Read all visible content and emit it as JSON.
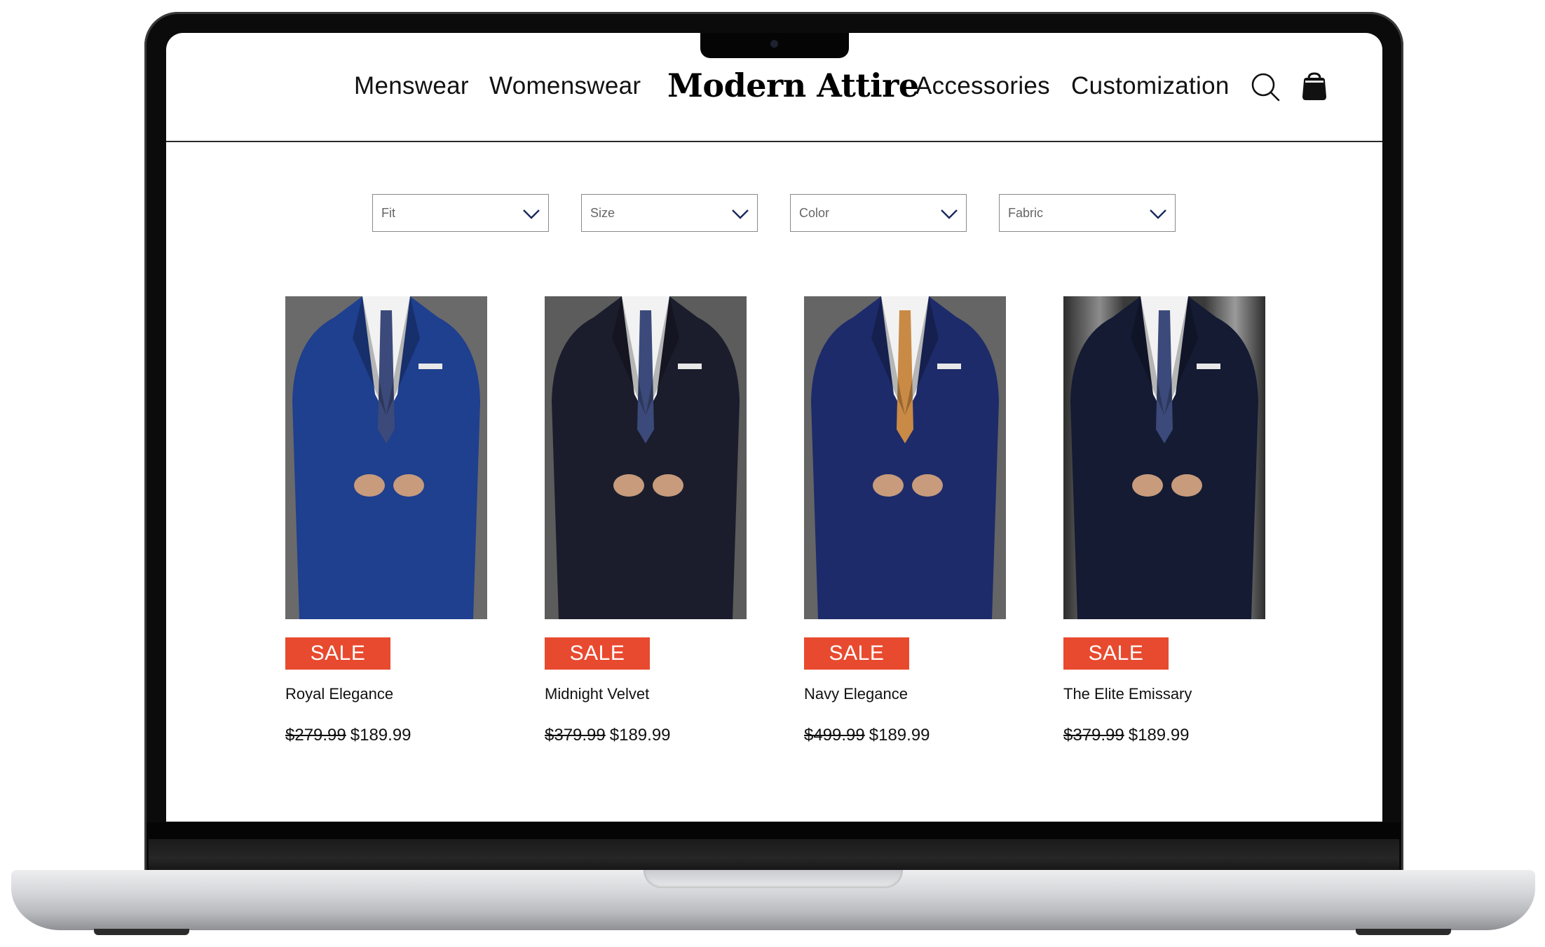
{
  "nav": {
    "left": [
      "Menswear",
      "Womenswear"
    ],
    "brand": "Modern Attire",
    "right": [
      "Accessories",
      "Customization"
    ]
  },
  "icons": {
    "search": "search-icon",
    "cart": "shopping-bag-icon"
  },
  "filters": [
    "Fit",
    "Size",
    "Color",
    "Fabric"
  ],
  "products": [
    {
      "badge": "SALE",
      "name": "Royal Elegance",
      "old_price": "$279.99",
      "price": "$189.99",
      "suit_color": "#1f3f8f"
    },
    {
      "badge": "SALE",
      "name": "Midnight Velvet",
      "old_price": "$379.99",
      "price": "$189.99",
      "suit_color": "#1b1d2c"
    },
    {
      "badge": "SALE",
      "name": "Navy Elegance",
      "old_price": "$499.99",
      "price": "$189.99",
      "suit_color": "#1d2b6a"
    },
    {
      "badge": "SALE",
      "name": "The Elite Emissary",
      "old_price": "$379.99",
      "price": "$189.99",
      "suit_color": "#141b33"
    }
  ],
  "colors": {
    "sale_badge": "#e84a2f",
    "text": "#111111"
  }
}
